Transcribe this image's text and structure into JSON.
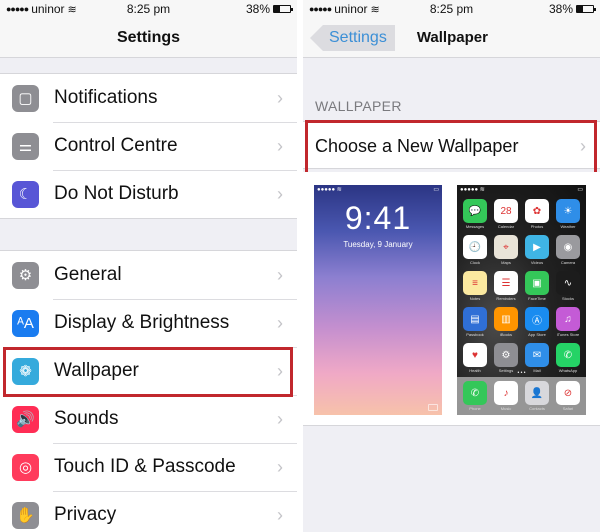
{
  "status_bar": {
    "signal": "●●●●●",
    "carrier": "uninor",
    "wifi_icon": "wifi-icon",
    "time": "8:25 pm",
    "battery_percent_label": "38%",
    "battery_level": 0.38
  },
  "left": {
    "title": "Settings",
    "groups": [
      [
        {
          "label": "Notifications",
          "icon": "notifications-icon",
          "color": "#8e8e93",
          "glyph": "▢"
        },
        {
          "label": "Control Centre",
          "icon": "control-centre-icon",
          "color": "#8e8e93",
          "glyph": "⚌"
        },
        {
          "label": "Do Not Disturb",
          "icon": "moon-icon",
          "color": "#5856d6",
          "glyph": "☾"
        }
      ],
      [
        {
          "label": "General",
          "icon": "gear-icon",
          "color": "#8e8e93",
          "glyph": "⚙"
        },
        {
          "label": "Display & Brightness",
          "icon": "display-brightness-icon",
          "color": "#1a7cf0",
          "glyph": "ᴬA"
        },
        {
          "label": "Wallpaper",
          "icon": "wallpaper-icon",
          "color": "#35aadc",
          "glyph": "❁"
        },
        {
          "label": "Sounds",
          "icon": "speaker-icon",
          "color": "#ff2d55",
          "glyph": "🔊"
        },
        {
          "label": "Touch ID & Passcode",
          "icon": "fingerprint-icon",
          "color": "#ff3b5c",
          "glyph": "◎"
        },
        {
          "label": "Privacy",
          "icon": "hand-icon",
          "color": "#8e8e93",
          "glyph": "✋"
        }
      ]
    ],
    "chevron": "›"
  },
  "right": {
    "back_label": "Settings",
    "title": "Wallpaper",
    "section_header": "WALLPAPER",
    "choose_label": "Choose a New Wallpaper",
    "chevron": "›",
    "lock_screen": {
      "time": "9:41",
      "date": "Tuesday, 9 January"
    },
    "home_screen": {
      "apps": [
        {
          "name": "Messages",
          "color": "#34c759",
          "glyph": "💬"
        },
        {
          "name": "Calendar",
          "color": "#ffffff",
          "glyph": "28"
        },
        {
          "name": "Photos",
          "color": "#ffffff",
          "glyph": "✿"
        },
        {
          "name": "Weather",
          "color": "#2f8ee8",
          "glyph": "☀"
        },
        {
          "name": "Clock",
          "color": "#ffffff",
          "glyph": "🕘"
        },
        {
          "name": "Maps",
          "color": "#e9e4d8",
          "glyph": "⌖"
        },
        {
          "name": "Videos",
          "color": "#3fb5e5",
          "glyph": "▶"
        },
        {
          "name": "Camera",
          "color": "#9a9a9e",
          "glyph": "◉"
        },
        {
          "name": "Notes",
          "color": "#fbe9a0",
          "glyph": "≡"
        },
        {
          "name": "Reminders",
          "color": "#ffffff",
          "glyph": "☰"
        },
        {
          "name": "FaceTime",
          "color": "#34c759",
          "glyph": "▣"
        },
        {
          "name": "Stocks",
          "color": "#1c1c1c",
          "glyph": "∿"
        },
        {
          "name": "Passbook",
          "color": "#2f6fd6",
          "glyph": "▤"
        },
        {
          "name": "iBooks",
          "color": "#ff9500",
          "glyph": "▥"
        },
        {
          "name": "App Store",
          "color": "#1a8cf0",
          "glyph": "Ⓐ"
        },
        {
          "name": "iTunes Store",
          "color": "#c45bd6",
          "glyph": "♫"
        },
        {
          "name": "Health",
          "color": "#ffffff",
          "glyph": "♥"
        },
        {
          "name": "Settings",
          "color": "#8e8e93",
          "glyph": "⚙"
        },
        {
          "name": "Mail",
          "color": "#2f8ee8",
          "glyph": "✉"
        },
        {
          "name": "WhatsApp",
          "color": "#25d366",
          "glyph": "✆"
        }
      ],
      "dock": [
        {
          "name": "Phone",
          "color": "#34c759",
          "glyph": "✆"
        },
        {
          "name": "Music",
          "color": "#ffffff",
          "glyph": "♪"
        },
        {
          "name": "Contacts",
          "color": "#d8d8dc",
          "glyph": "👤"
        },
        {
          "name": "Safari",
          "color": "#ffffff",
          "glyph": "⊘"
        }
      ]
    }
  },
  "highlight_color": "#c1272d"
}
